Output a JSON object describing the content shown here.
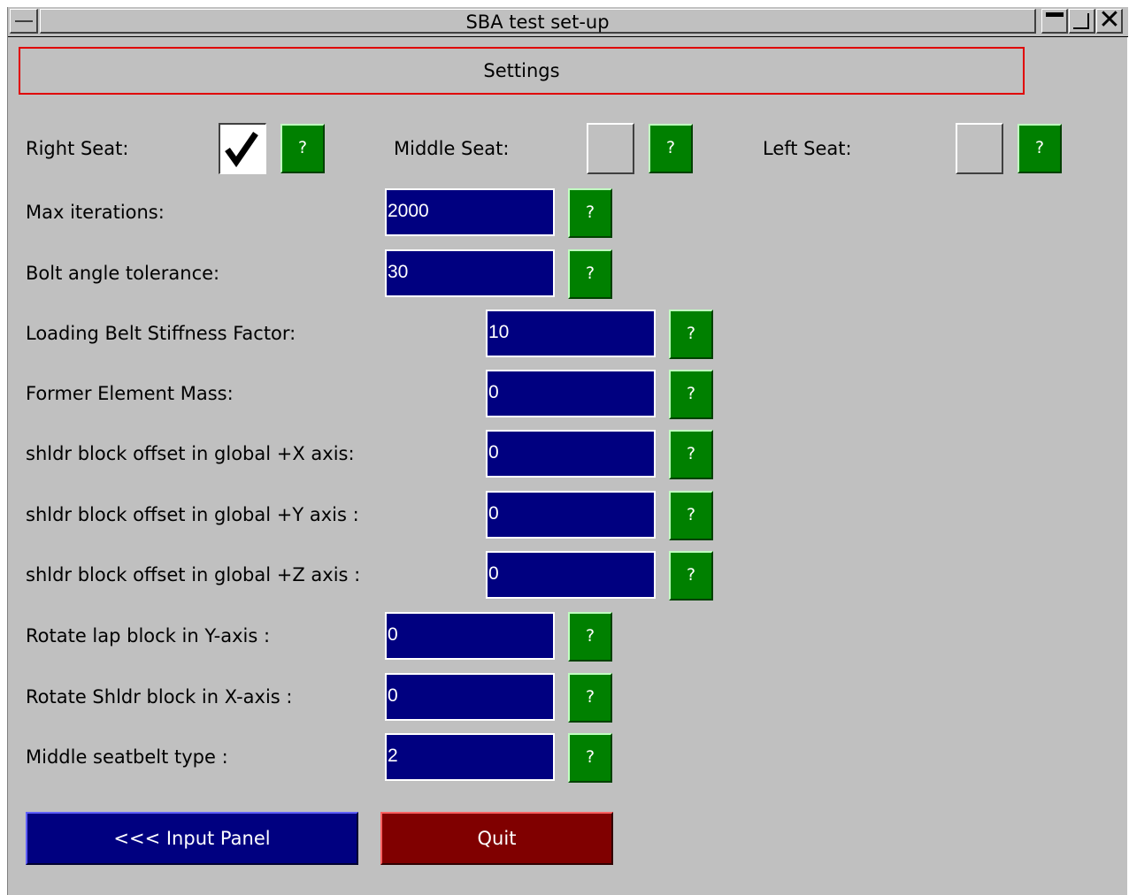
{
  "window": {
    "title": "SBA test set-up"
  },
  "header": {
    "settings_label": "Settings"
  },
  "seats": {
    "right_label": "Right Seat:",
    "right_checked": true,
    "middle_label": "Middle Seat:",
    "middle_checked": false,
    "left_label": "Left Seat:",
    "left_checked": false
  },
  "help_label": "?",
  "fields": {
    "max_iterations": {
      "label": "Max iterations:",
      "value": "2000"
    },
    "bolt_angle": {
      "label": "Bolt angle tolerance:",
      "value": "30"
    },
    "belt_stiffness": {
      "label": "Loading Belt Stiffness Factor:",
      "value": "10"
    },
    "former_mass": {
      "label": "Former Element Mass:",
      "value": "0"
    },
    "offset_x": {
      "label": "shldr block offset in global +X axis:",
      "value": "0"
    },
    "offset_y": {
      "label": "shldr block offset in global +Y axis :",
      "value": "0"
    },
    "offset_z": {
      "label": "shldr block offset in global +Z axis :",
      "value": "0"
    },
    "rotate_lap": {
      "label": "Rotate lap block in Y-axis :",
      "value": "0"
    },
    "rotate_shldr": {
      "label": "Rotate Shldr block in X-axis :",
      "value": "0"
    },
    "middle_type": {
      "label": "Middle seatbelt type :",
      "value": "2"
    }
  },
  "buttons": {
    "input_panel": "<<< Input Panel",
    "quit": "Quit"
  },
  "colors": {
    "field_bg": "#000080",
    "help_bg": "#008000",
    "quit_bg": "#800000",
    "panel_bg": "#c0c0c0"
  },
  "icons": {
    "check": "checkmark-icon",
    "close": "close-icon",
    "minimize": "minimize-icon",
    "maximize": "maximize-icon"
  }
}
